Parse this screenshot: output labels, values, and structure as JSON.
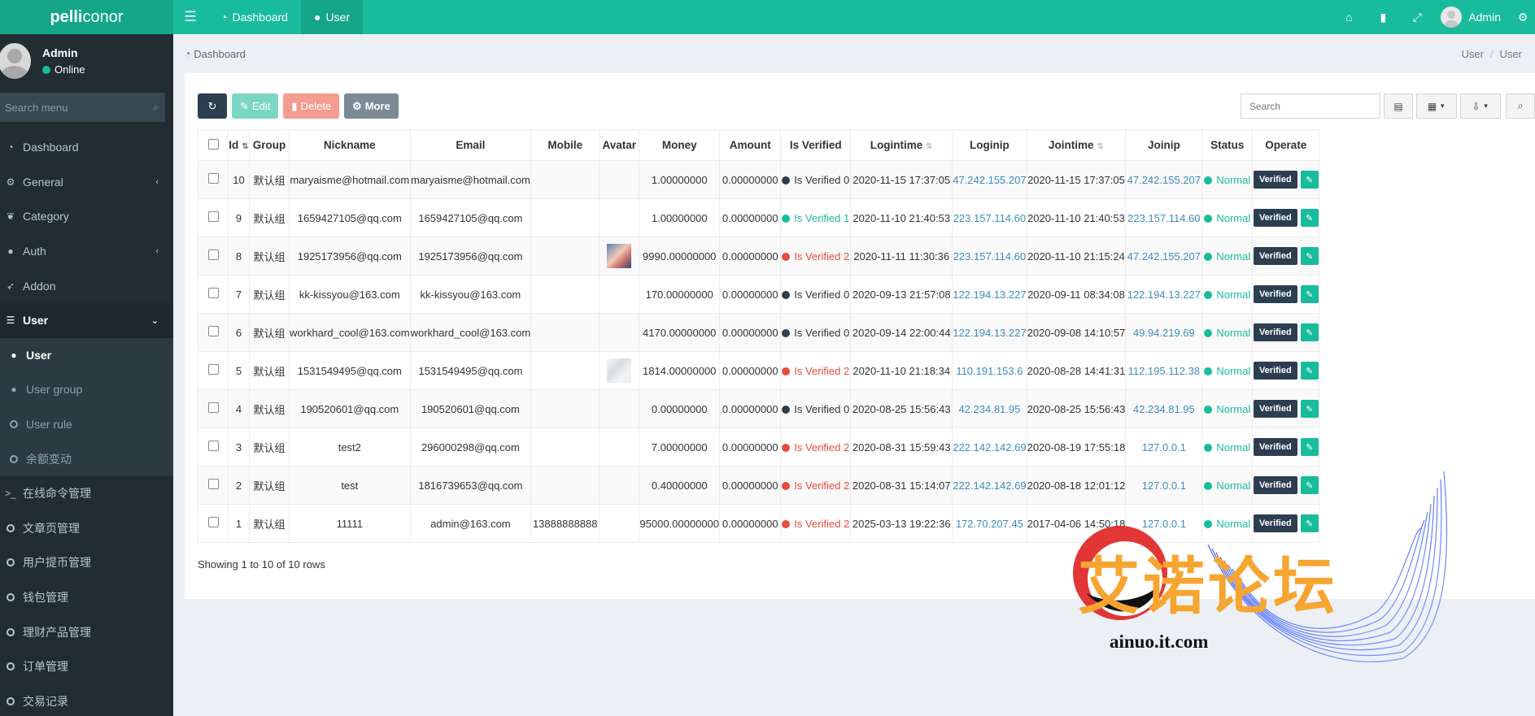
{
  "header": {
    "logo_pre": "pelli",
    "logo_post": "conor",
    "tabs": [
      {
        "label": "Dashboard",
        "icon": "dashboard-icon"
      },
      {
        "label": "User",
        "icon": "user-icon"
      }
    ],
    "admin_name": "Admin"
  },
  "sidebar": {
    "user_name": "Admin",
    "user_status": "Online",
    "search_placeholder": "Search menu",
    "items": [
      {
        "label": "Dashboard"
      },
      {
        "label": "General"
      },
      {
        "label": "Category"
      },
      {
        "label": "Auth"
      },
      {
        "label": "Addon"
      },
      {
        "label": "User"
      },
      {
        "label": "User"
      },
      {
        "label": "User group"
      },
      {
        "label": "User rule"
      },
      {
        "label": "余额变动"
      },
      {
        "label": "在线命令管理"
      },
      {
        "label": "文章页管理"
      },
      {
        "label": "用户提币管理"
      },
      {
        "label": "钱包管理"
      },
      {
        "label": "理财产品管理"
      },
      {
        "label": "订单管理"
      },
      {
        "label": "交易记录"
      }
    ]
  },
  "breadcrumb": {
    "left": "Dashboard",
    "right_1": "User",
    "sep": "/",
    "right_2": "User"
  },
  "toolbar": {
    "edit_label": "Edit",
    "delete_label": "Delete",
    "more_label": "More",
    "search_placeholder": "Search"
  },
  "table": {
    "headers": [
      "Id",
      "Group",
      "Nickname",
      "Email",
      "Mobile",
      "Avatar",
      "Money",
      "Amount",
      "Is Verified",
      "Logintime",
      "Loginip",
      "Jointime",
      "Joinip",
      "Status",
      "Operate"
    ],
    "rows": [
      {
        "id": "10",
        "group": "默认组",
        "nickname": "maryaisme@hotmail.com",
        "email": "maryaisme@hotmail.com",
        "mobile": "",
        "money": "1.00000000",
        "amount": "0.00000000",
        "verified": "Is Verified 0",
        "logintime": "2020-11-15 17:37:05",
        "loginip": "47.242.155.207",
        "jointime": "2020-11-15 17:37:05",
        "joinip": "47.242.155.207",
        "status": "Normal"
      },
      {
        "id": "9",
        "group": "默认组",
        "nickname": "1659427105@qq.com",
        "email": "1659427105@qq.com",
        "mobile": "",
        "money": "1.00000000",
        "amount": "0.00000000",
        "verified": "Is Verified 1",
        "logintime": "2020-11-10 21:40:53",
        "loginip": "223.157.114.60",
        "jointime": "2020-11-10 21:40:53",
        "joinip": "223.157.114.60",
        "status": "Normal"
      },
      {
        "id": "8",
        "group": "默认组",
        "nickname": "1925173956@qq.com",
        "email": "1925173956@qq.com",
        "mobile": "",
        "money": "9990.00000000",
        "amount": "0.00000000",
        "verified": "Is Verified 2",
        "logintime": "2020-11-11 11:30:36",
        "loginip": "223.157.114.60",
        "jointime": "2020-11-10 21:15:24",
        "joinip": "47.242.155.207",
        "status": "Normal"
      },
      {
        "id": "7",
        "group": "默认组",
        "nickname": "kk-kissyou@163.com",
        "email": "kk-kissyou@163.com",
        "mobile": "",
        "money": "170.00000000",
        "amount": "0.00000000",
        "verified": "Is Verified 0",
        "logintime": "2020-09-13 21:57:08",
        "loginip": "122.194.13.227",
        "jointime": "2020-09-11 08:34:08",
        "joinip": "122.194.13.227",
        "status": "Normal"
      },
      {
        "id": "6",
        "group": "默认组",
        "nickname": "workhard_cool@163.com",
        "email": "workhard_cool@163.com",
        "mobile": "",
        "money": "4170.00000000",
        "amount": "0.00000000",
        "verified": "Is Verified 0",
        "logintime": "2020-09-14 22:00:44",
        "loginip": "122.194.13.227",
        "jointime": "2020-09-08 14:10:57",
        "joinip": "49.94.219.69",
        "status": "Normal"
      },
      {
        "id": "5",
        "group": "默认组",
        "nickname": "1531549495@qq.com",
        "email": "1531549495@qq.com",
        "mobile": "",
        "money": "1814.00000000",
        "amount": "0.00000000",
        "verified": "Is Verified 2",
        "logintime": "2020-11-10 21:18:34",
        "loginip": "110.191.153.6",
        "jointime": "2020-08-28 14:41:31",
        "joinip": "112.195.112.38",
        "status": "Normal"
      },
      {
        "id": "4",
        "group": "默认组",
        "nickname": "190520601@qq.com",
        "email": "190520601@qq.com",
        "mobile": "",
        "money": "0.00000000",
        "amount": "0.00000000",
        "verified": "Is Verified 0",
        "logintime": "2020-08-25 15:56:43",
        "loginip": "42.234.81.95",
        "jointime": "2020-08-25 15:56:43",
        "joinip": "42.234.81.95",
        "status": "Normal"
      },
      {
        "id": "3",
        "group": "默认组",
        "nickname": "test2",
        "email": "296000298@qq.com",
        "mobile": "",
        "money": "7.00000000",
        "amount": "0.00000000",
        "verified": "Is Verified 2",
        "logintime": "2020-08-31 15:59:43",
        "loginip": "222.142.142.69",
        "jointime": "2020-08-19 17:55:18",
        "joinip": "127.0.0.1",
        "status": "Normal"
      },
      {
        "id": "2",
        "group": "默认组",
        "nickname": "test",
        "email": "1816739653@qq.com",
        "mobile": "",
        "money": "0.40000000",
        "amount": "0.00000000",
        "verified": "Is Verified 2",
        "logintime": "2020-08-31 15:14:07",
        "loginip": "222.142.142.69",
        "jointime": "2020-08-18 12:01:12",
        "joinip": "127.0.0.1",
        "status": "Normal"
      },
      {
        "id": "1",
        "group": "默认组",
        "nickname": "11111",
        "email": "admin@163.com",
        "mobile": "13888888888",
        "money": "95000.00000000",
        "amount": "0.00000000",
        "verified": "Is Verified 2",
        "logintime": "2025-03-13 19:22:36",
        "loginip": "172.70.207.45",
        "jointime": "2017-04-06 14:50:18",
        "joinip": "127.0.0.1",
        "status": "Normal"
      }
    ],
    "operate_label": "Verified",
    "footer": "Showing 1 to 10 of 10 rows"
  },
  "watermark": {
    "title": "艾诺论坛",
    "url": "ainuo.it.com"
  },
  "colors": {
    "primary": "#18bc9c",
    "sidebar": "#222d32",
    "dark": "#2c3e50",
    "danger": "#e74c3c",
    "link": "#3c8dbc"
  }
}
